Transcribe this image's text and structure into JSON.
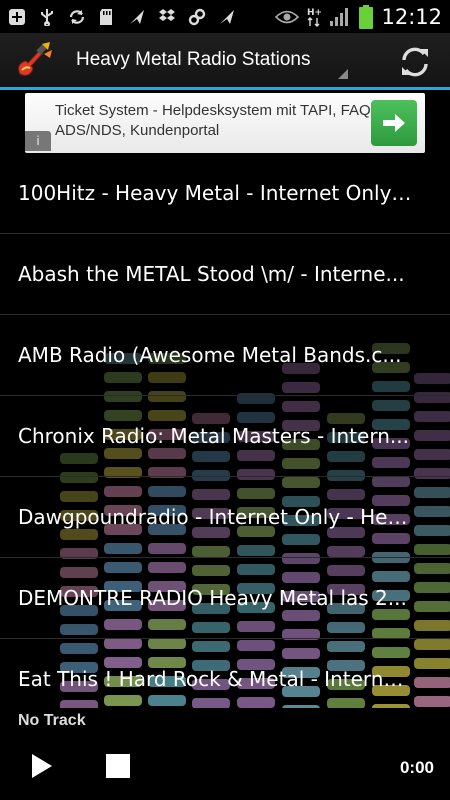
{
  "status_bar": {
    "time": "12:12",
    "icons": [
      "add-icon",
      "usb-icon",
      "sync-icon",
      "sd-card-icon",
      "plane-icon",
      "dropbox-icon",
      "link-icon",
      "plane-icon",
      "eye-icon",
      "hplus-data-icon",
      "signal-icon",
      "battery-icon"
    ]
  },
  "action_bar": {
    "title": "Heavy Metal Radio Stations",
    "icons": {
      "logo": "guitar-logo-icon",
      "refresh": "refresh-icon"
    }
  },
  "ad": {
    "text": "Ticket System - Helpdesksystem mit TAPI, FAQ, ADS/NDS, Kundenportal",
    "info_label": "i",
    "button_icon": "arrow-right-icon"
  },
  "stations": [
    {
      "label": "100Hitz - Heavy Metal - Internet Only -..."
    },
    {
      "label": "Abash the METAL Stood \\m/ - Interne..."
    },
    {
      "label": "AMB Radio (Awesome Metal Bands.c..."
    },
    {
      "label": "Chronix Radio: Metal Masters - Intern..."
    },
    {
      "label": "Dawgpoundradio - Internet Only - Hea..."
    },
    {
      "label": "DEMONTRE RADIO Heavy Metal las 2..."
    },
    {
      "label": "Eat This ! Hard Rock & Metal - Internet..."
    }
  ],
  "player": {
    "track": "No Track",
    "time": "0:00",
    "icons": {
      "play": "play-icon",
      "stop": "stop-icon"
    }
  },
  "colors": {
    "accent": "#2aa7d7",
    "ad_button": "#3cae4c",
    "battery": "#6ad03a"
  }
}
